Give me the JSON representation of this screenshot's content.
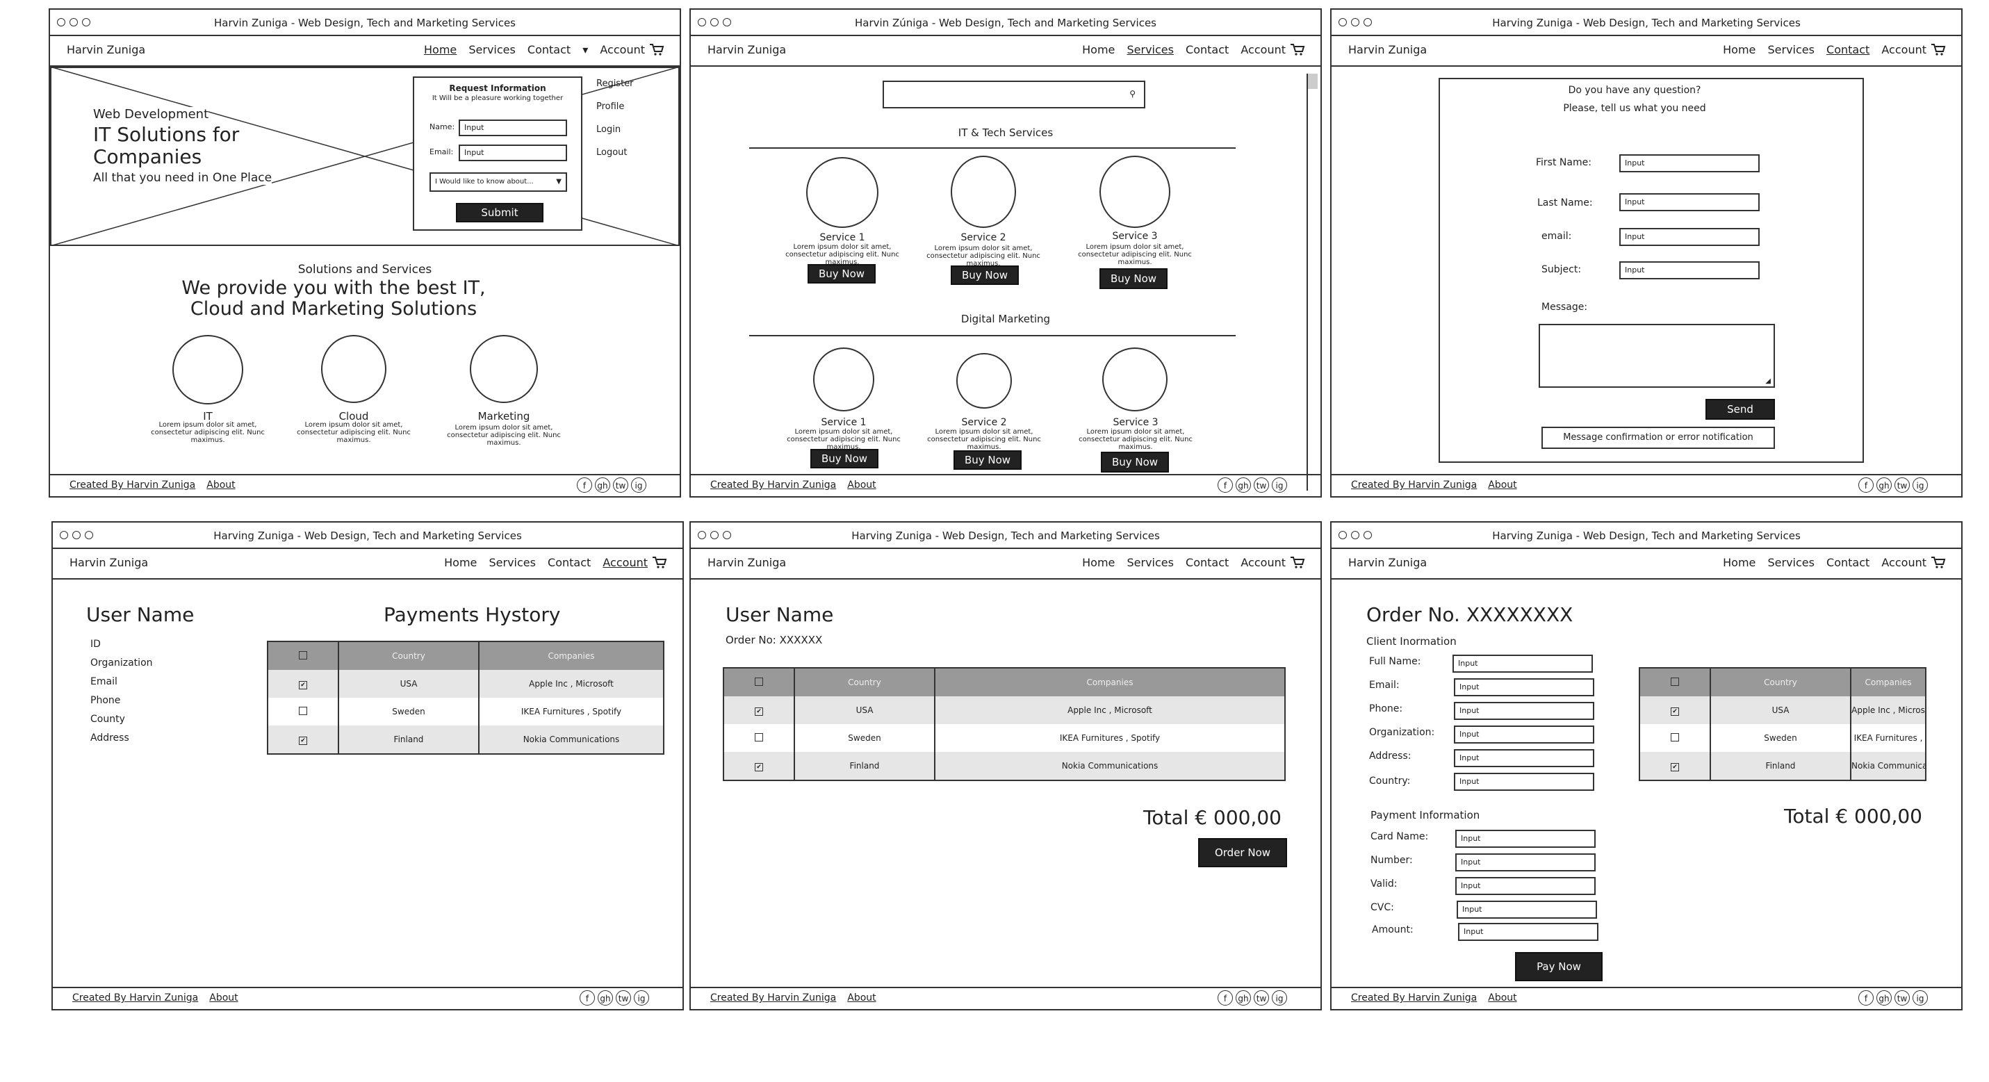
{
  "windows": [
    {
      "title": "Harvin Zuniga - Web Design, Tech and Marketing Services",
      "brand": "Harvin Zuniga",
      "nav": [
        "Home",
        "Services",
        "Contact",
        "Account"
      ]
    },
    {
      "title": "Harvin Zúniga - Web Design, Tech and Marketing Services",
      "brand": "Harvin Zuniga",
      "nav": [
        "Home",
        "Services",
        "Contact",
        "Account"
      ]
    },
    {
      "title": "Harving Zuniga - Web Design, Tech and Marketing Services",
      "brand": "Harvin Zuniga",
      "nav": [
        "Home",
        "Services",
        "Contact",
        "Account"
      ]
    },
    {
      "title": "Harving Zuniga - Web Design, Tech and Marketing Services",
      "brand": "Harvin Zuniga",
      "nav": [
        "Home",
        "Services",
        "Contact",
        "Account"
      ]
    },
    {
      "title": "Harving Zuniga - Web Design, Tech and Marketing Services",
      "brand": "Harvin Zuniga",
      "nav": [
        "Home",
        "Services",
        "Contact",
        "Account"
      ]
    },
    {
      "title": "Harving Zuniga - Web Design, Tech and Marketing Services",
      "brand": "Harvin Zuniga",
      "nav": [
        "Home",
        "Services",
        "Contact",
        "Account"
      ]
    }
  ],
  "footer": {
    "created": "Created By Harvin Zuniga",
    "about": "About",
    "social": [
      "f",
      "gh",
      "tw",
      "ig"
    ]
  },
  "home": {
    "hero_kicker": "Web Development",
    "hero_title_1": "IT Solutions for",
    "hero_title_2": "Companies",
    "hero_sub": "All that you need in One Place",
    "form_title": "Request Information",
    "form_sub": "It Will be a pleasure working together",
    "name_label": "Name:",
    "email_label": "Email:",
    "input": "Input",
    "select": "I Would like to know about...",
    "submit": "Submit",
    "menu": [
      "Register",
      "Profile",
      "Login",
      "Logout"
    ],
    "section_kicker": "Solutions and Services",
    "section_title_1": "We provide you with the best IT,",
    "section_title_2": "Cloud and Marketing Solutions",
    "items": [
      "IT",
      "Cloud",
      "Marketing"
    ],
    "lorem": "Lorem ipsum dolor sit amet, consectetur adipiscing elit. Nunc maximus."
  },
  "services": {
    "group1": "IT & Tech Services",
    "group2": "Digital Marketing",
    "items": [
      "Service 1",
      "Service 2",
      "Service 3"
    ],
    "buy": "Buy Now"
  },
  "contact": {
    "q1": "Do you have any question?",
    "q2": "Please, tell us what you need",
    "labels": [
      "First Name:",
      "Last Name:",
      "email:",
      "Subject:"
    ],
    "message": "Message:",
    "send": "Send",
    "notify": "Message confirmation or error notification"
  },
  "table": {
    "headers": [
      "Country",
      "Companies"
    ],
    "rows": [
      {
        "country": "USA",
        "companies": "Apple Inc , Microsoft",
        "checked": true
      },
      {
        "country": "Sweden",
        "companies": "IKEA Furnitures , Spotify",
        "checked": false
      },
      {
        "country": "Finland",
        "companies": "Nokia Communications",
        "checked": true
      }
    ],
    "rows_trunc": [
      {
        "country": "USA",
        "companies": "Apple Inc , Micros"
      },
      {
        "country": "Sweden",
        "companies": "IKEA Furnitures ,"
      },
      {
        "country": "Finland",
        "companies": "Nokia Communica"
      }
    ]
  },
  "account": {
    "user": "User Name",
    "fields": [
      "ID",
      "Organization",
      "Email",
      "Phone",
      "County",
      "Address"
    ],
    "payments": "Payments Hystory"
  },
  "cart": {
    "user": "User Name",
    "order": "Order No: XXXXXX",
    "total": "Total € 000,00",
    "order_now": "Order Now"
  },
  "order": {
    "title": "Order No. XXXXXXXX",
    "client": "Client Inormation",
    "client_fields": [
      "Full Name:",
      "Email:",
      "Phone:",
      "Organization:",
      "Address:",
      "Country:"
    ],
    "payment": "Payment Information",
    "payment_fields": [
      "Card Name:",
      "Number:",
      "Valid:",
      "CVC:",
      "Amount:"
    ],
    "total": "Total € 000,00",
    "pay": "Pay Now"
  }
}
